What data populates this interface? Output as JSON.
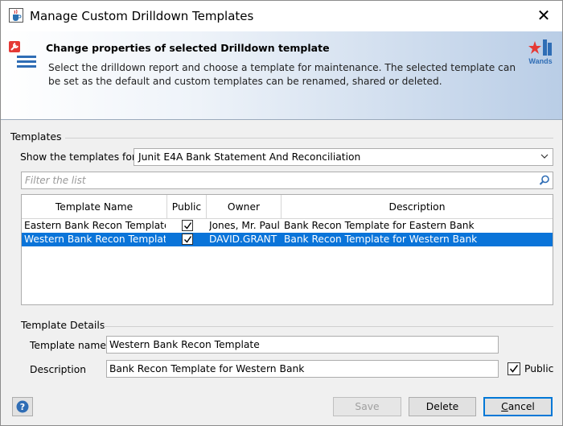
{
  "window": {
    "title": "Manage Custom Drilldown Templates",
    "close_glyph": "✕"
  },
  "banner": {
    "title": "Change properties of selected Drilldown template",
    "description": "Select the drilldown report and choose a template for maintenance. The selected template can be set as the default and custom templates can be renamed, shared or deleted.",
    "logo_text": "Wands"
  },
  "templates_group": {
    "label": "Templates",
    "show_label": "Show the templates for",
    "selected_report": "Junit E4A Bank Statement And Reconciliation",
    "filter_placeholder": "Filter the list",
    "filter_value": ""
  },
  "table": {
    "columns": [
      "Template Name",
      "Public",
      "Owner",
      "Description"
    ],
    "rows": [
      {
        "name": "Eastern Bank Recon Template",
        "public": true,
        "owner": "Jones, Mr. Paul",
        "description": "Bank Recon Template for Eastern Bank",
        "selected": false
      },
      {
        "name": "Western Bank Recon Template",
        "public": true,
        "owner": "DAVID.GRANT",
        "description": "Bank Recon Template for Western Bank",
        "selected": true
      }
    ]
  },
  "details": {
    "label": "Template Details",
    "name_label": "Template name",
    "name_value": "Western Bank Recon Template",
    "description_label": "Description",
    "description_value": "Bank Recon Template for Western Bank",
    "public_label": "Public",
    "public_checked": true
  },
  "buttons": {
    "help": "?",
    "save": "Save",
    "delete": "Delete",
    "cancel_first": "C",
    "cancel_rest": "ancel"
  },
  "colors": {
    "selection": "#0a74d9",
    "banner_gradient_end": "#b9cde6",
    "default_button_border": "#0078d7"
  },
  "icons": {
    "app": "java-cup-icon",
    "banner": "wrench-list-icon",
    "logo": "wands-logo-icon",
    "filter": "search-icon",
    "combo": "chevron-down-icon",
    "help": "help-icon"
  }
}
